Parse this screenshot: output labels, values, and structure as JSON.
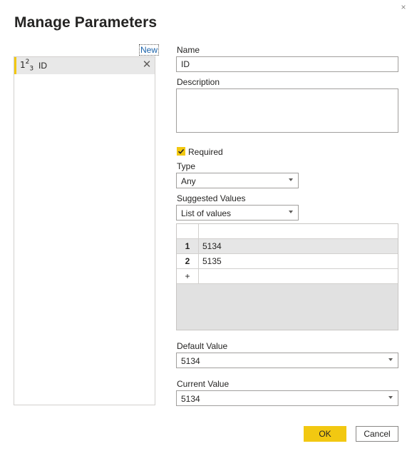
{
  "dialog": {
    "title": "Manage Parameters",
    "close_glyph": "×",
    "new_link": "New"
  },
  "parameters": [
    {
      "type_icon": "number-type-icon",
      "name": "ID",
      "selected": true
    }
  ],
  "form": {
    "name_label": "Name",
    "name_value": "ID",
    "description_label": "Description",
    "description_value": "",
    "required_label": "Required",
    "required_checked": true,
    "type_label": "Type",
    "type_value": "Any",
    "suggested_values_label": "Suggested Values",
    "suggested_values_value": "List of values",
    "values_list": [
      {
        "index": "1",
        "value": "5134"
      },
      {
        "index": "2",
        "value": "5135"
      }
    ],
    "add_row_glyph": "+",
    "default_value_label": "Default Value",
    "default_value": "5134",
    "current_value_label": "Current Value",
    "current_value": "5134"
  },
  "buttons": {
    "ok": "OK",
    "cancel": "Cancel"
  },
  "colors": {
    "accent": "#f2c811",
    "link": "#1a62a9",
    "selected_item_bg": "#e8e8e8"
  }
}
